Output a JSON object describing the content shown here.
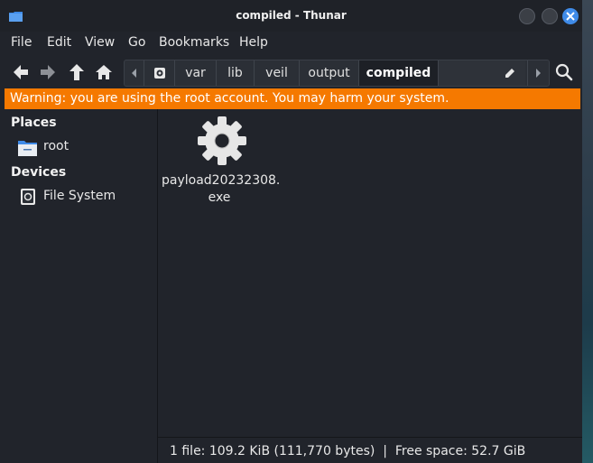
{
  "window": {
    "title": "compiled - Thunar"
  },
  "menu": [
    "File",
    "Edit",
    "View",
    "Go",
    "Bookmarks",
    "Help"
  ],
  "toolbar": {
    "back": "arrow-left-icon",
    "forward": "arrow-right-icon",
    "up": "arrow-up-icon",
    "home": "home-icon",
    "search": "search-icon"
  },
  "pathbar": {
    "segments": [
      "var",
      "lib",
      "veil",
      "output",
      "compiled"
    ],
    "active": "compiled"
  },
  "warning": "Warning: you are using the root account. You may harm your system.",
  "sidebar": {
    "places_header": "Places",
    "places": [
      {
        "label": "root",
        "icon": "folder-icon"
      }
    ],
    "devices_header": "Devices",
    "devices": [
      {
        "label": "File System",
        "icon": "drive-icon"
      }
    ]
  },
  "files": [
    {
      "name": "payload20232308.\nexe",
      "icon": "gear-icon"
    }
  ],
  "status": "1 file: 109.2 KiB (111,770 bytes)  |  Free space: 52.7 GiB",
  "colors": {
    "accent": "#3f8be8",
    "warning": "#f57900",
    "background": "#21242b"
  }
}
